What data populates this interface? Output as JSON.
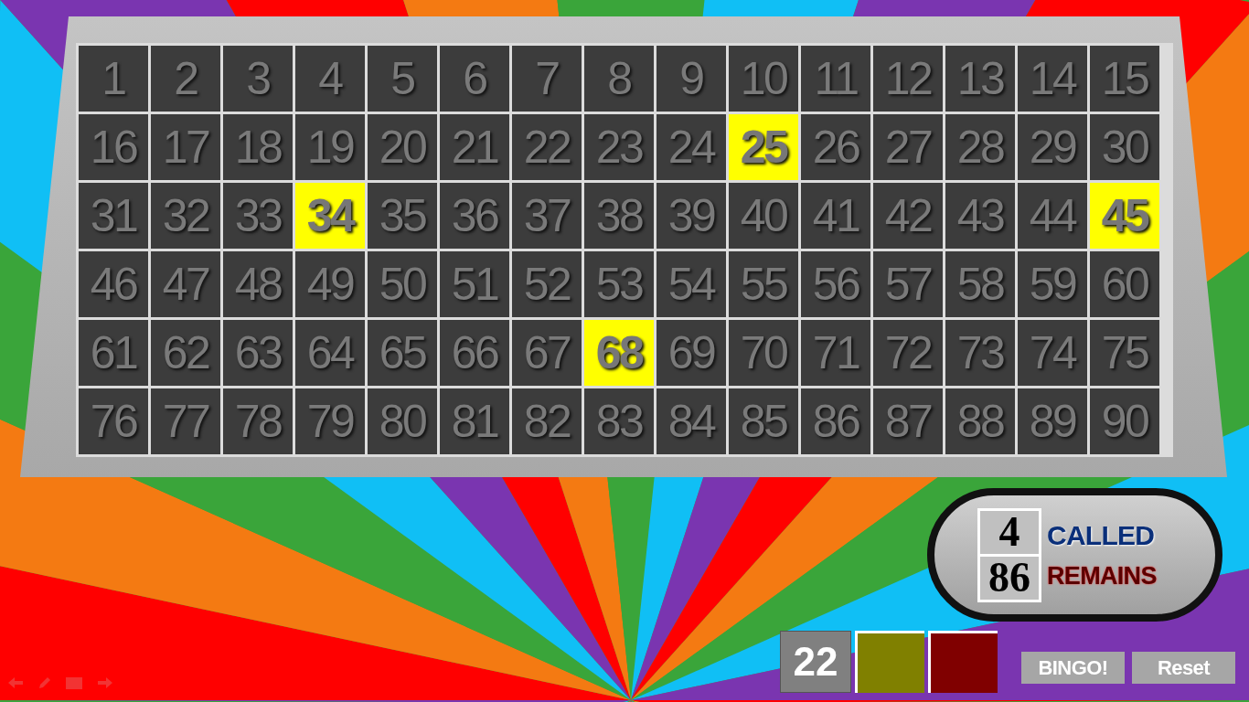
{
  "board": {
    "numbers": [
      {
        "label": "1",
        "selected": false
      },
      {
        "label": "2",
        "selected": false
      },
      {
        "label": "3",
        "selected": false
      },
      {
        "label": "4",
        "selected": false
      },
      {
        "label": "5",
        "selected": false
      },
      {
        "label": "6",
        "selected": false
      },
      {
        "label": "7",
        "selected": false
      },
      {
        "label": "8",
        "selected": false
      },
      {
        "label": "9",
        "selected": false
      },
      {
        "label": "10",
        "selected": false
      },
      {
        "label": "11",
        "selected": false
      },
      {
        "label": "12",
        "selected": false
      },
      {
        "label": "13",
        "selected": false
      },
      {
        "label": "14",
        "selected": false
      },
      {
        "label": "15",
        "selected": false
      },
      {
        "label": "16",
        "selected": false
      },
      {
        "label": "17",
        "selected": false
      },
      {
        "label": "18",
        "selected": false
      },
      {
        "label": "19",
        "selected": false
      },
      {
        "label": "20",
        "selected": false
      },
      {
        "label": "21",
        "selected": false
      },
      {
        "label": "22",
        "selected": false
      },
      {
        "label": "23",
        "selected": false
      },
      {
        "label": "24",
        "selected": false
      },
      {
        "label": "25",
        "selected": true
      },
      {
        "label": "26",
        "selected": false
      },
      {
        "label": "27",
        "selected": false
      },
      {
        "label": "28",
        "selected": false
      },
      {
        "label": "29",
        "selected": false
      },
      {
        "label": "30",
        "selected": false
      },
      {
        "label": "31",
        "selected": false
      },
      {
        "label": "32",
        "selected": false
      },
      {
        "label": "33",
        "selected": false
      },
      {
        "label": "34",
        "selected": true
      },
      {
        "label": "35",
        "selected": false
      },
      {
        "label": "36",
        "selected": false
      },
      {
        "label": "37",
        "selected": false
      },
      {
        "label": "38",
        "selected": false
      },
      {
        "label": "39",
        "selected": false
      },
      {
        "label": "40",
        "selected": false
      },
      {
        "label": "41",
        "selected": false
      },
      {
        "label": "42",
        "selected": false
      },
      {
        "label": "43",
        "selected": false
      },
      {
        "label": "44",
        "selected": false
      },
      {
        "label": "45",
        "selected": true
      },
      {
        "label": "46",
        "selected": false
      },
      {
        "label": "47",
        "selected": false
      },
      {
        "label": "48",
        "selected": false
      },
      {
        "label": "49",
        "selected": false
      },
      {
        "label": "50",
        "selected": false
      },
      {
        "label": "51",
        "selected": false
      },
      {
        "label": "52",
        "selected": false
      },
      {
        "label": "53",
        "selected": false
      },
      {
        "label": "54",
        "selected": false
      },
      {
        "label": "55",
        "selected": false
      },
      {
        "label": "56",
        "selected": false
      },
      {
        "label": "57",
        "selected": false
      },
      {
        "label": "58",
        "selected": false
      },
      {
        "label": "59",
        "selected": false
      },
      {
        "label": "60",
        "selected": false
      },
      {
        "label": "61",
        "selected": false
      },
      {
        "label": "62",
        "selected": false
      },
      {
        "label": "63",
        "selected": false
      },
      {
        "label": "64",
        "selected": false
      },
      {
        "label": "65",
        "selected": false
      },
      {
        "label": "66",
        "selected": false
      },
      {
        "label": "67",
        "selected": false
      },
      {
        "label": "68",
        "selected": true
      },
      {
        "label": "69",
        "selected": false
      },
      {
        "label": "70",
        "selected": false
      },
      {
        "label": "71",
        "selected": false
      },
      {
        "label": "72",
        "selected": false
      },
      {
        "label": "73",
        "selected": false
      },
      {
        "label": "74",
        "selected": false
      },
      {
        "label": "75",
        "selected": false
      },
      {
        "label": "76",
        "selected": false
      },
      {
        "label": "77",
        "selected": false
      },
      {
        "label": "78",
        "selected": false
      },
      {
        "label": "79",
        "selected": false
      },
      {
        "label": "80",
        "selected": false
      },
      {
        "label": "81",
        "selected": false
      },
      {
        "label": "82",
        "selected": false
      },
      {
        "label": "83",
        "selected": false
      },
      {
        "label": "84",
        "selected": false
      },
      {
        "label": "85",
        "selected": false
      },
      {
        "label": "86",
        "selected": false
      },
      {
        "label": "87",
        "selected": false
      },
      {
        "label": "88",
        "selected": false
      },
      {
        "label": "89",
        "selected": false
      },
      {
        "label": "90",
        "selected": false
      }
    ]
  },
  "counter": {
    "called_count": "4",
    "called_label": "CALLED",
    "remaining_count": "86",
    "remaining_label": "REMAINS"
  },
  "current_number": "22",
  "swatches": [
    {
      "color": "#808000"
    },
    {
      "color": "#800000"
    }
  ],
  "buttons": [
    "BINGO!",
    "Reset"
  ]
}
